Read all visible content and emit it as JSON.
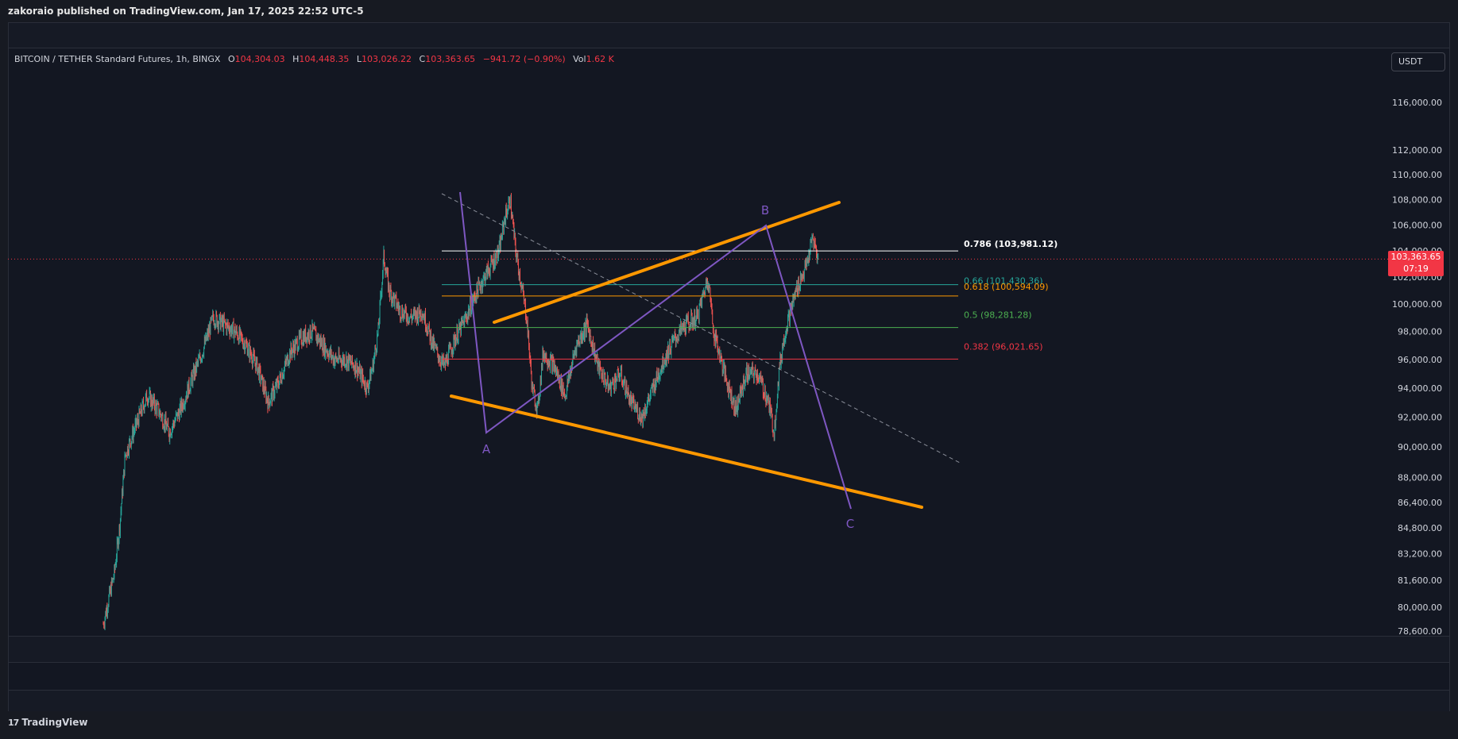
{
  "header": {
    "published": "zakoraio published on TradingView.com, Jan 17, 2025 22:52 UTC-5"
  },
  "legend": {
    "symbol": "BITCOIN / TETHER Standard Futures, 1h, BINGX",
    "o_label": "O",
    "o": "104,304.03",
    "h_label": "H",
    "h": "104,448.35",
    "l_label": "L",
    "l": "103,026.22",
    "c_label": "C",
    "c": "103,363.65",
    "change": "−941.72 (−0.90%)",
    "vol_label": "Vol",
    "vol": "1.62 K"
  },
  "currency": "USDT",
  "last_price": {
    "value": "103,363.65",
    "countdown": "07:19",
    "color": "#f23645"
  },
  "brand": {
    "logo": "17",
    "name": "TradingView"
  },
  "colors": {
    "up": "#26a69a",
    "down": "#ef5350",
    "channel": "#ff9800",
    "wave": "#7e57c2",
    "fib_786": "#ffffff",
    "fib_66": "#26a69a",
    "fib_618": "#ff9800",
    "fib_5": "#4caf50",
    "fib_382": "#f23645"
  },
  "chart_data": {
    "type": "candlestick",
    "title": "BITCOIN / TETHER Standard Futures, 1h, BINGX",
    "ylim": [
      78000,
      118000
    ],
    "y_scale": "log",
    "y_ticks": [
      "116,000.00",
      "112,000.00",
      "110,000.00",
      "108,000.00",
      "106,000.00",
      "104,000.00",
      "102,000.00",
      "100,000.00",
      "98,000.00",
      "96,000.00",
      "94,000.00",
      "92,000.00",
      "90,000.00",
      "88,000.00",
      "86,400.00",
      "84,800.00",
      "83,200.00",
      "81,600.00",
      "80,000.00",
      "78,600.00"
    ],
    "price_path": [
      [
        0,
        79000
      ],
      [
        0.4,
        82000
      ],
      [
        0.6,
        85000
      ],
      [
        0.8,
        89500
      ],
      [
        1.2,
        91500
      ],
      [
        1.6,
        93500
      ],
      [
        2.0,
        92500
      ],
      [
        2.4,
        91000
      ],
      [
        2.8,
        92500
      ],
      [
        3.2,
        94500
      ],
      [
        3.6,
        96500
      ],
      [
        4.0,
        99000
      ],
      [
        4.4,
        98500
      ],
      [
        4.8,
        98000
      ],
      [
        5.2,
        97000
      ],
      [
        5.6,
        95500
      ],
      [
        6.0,
        93000
      ],
      [
        6.4,
        94500
      ],
      [
        6.8,
        96500
      ],
      [
        7.2,
        97500
      ],
      [
        7.6,
        98000
      ],
      [
        8.0,
        97000
      ],
      [
        8.4,
        96000
      ],
      [
        8.8,
        96000
      ],
      [
        9.2,
        95500
      ],
      [
        9.6,
        94000
      ],
      [
        9.8,
        95500
      ],
      [
        10.0,
        98000
      ],
      [
        10.2,
        103500
      ],
      [
        10.4,
        101000
      ],
      [
        10.8,
        99500
      ],
      [
        11.2,
        99000
      ],
      [
        11.6,
        99500
      ],
      [
        12.0,
        97000
      ],
      [
        12.4,
        95500
      ],
      [
        12.8,
        97500
      ],
      [
        13.2,
        99000
      ],
      [
        13.6,
        101000
      ],
      [
        14.0,
        102500
      ],
      [
        14.4,
        104000
      ],
      [
        14.6,
        106500
      ],
      [
        14.8,
        108000
      ],
      [
        15.0,
        104000
      ],
      [
        15.2,
        101500
      ],
      [
        15.4,
        99000
      ],
      [
        15.6,
        94000
      ],
      [
        15.8,
        92500
      ],
      [
        16.0,
        96500
      ],
      [
        16.4,
        95500
      ],
      [
        16.8,
        93500
      ],
      [
        17.2,
        97000
      ],
      [
        17.6,
        98500
      ],
      [
        18.0,
        95500
      ],
      [
        18.4,
        94000
      ],
      [
        18.8,
        95000
      ],
      [
        19.2,
        93000
      ],
      [
        19.6,
        92000
      ],
      [
        20.0,
        94000
      ],
      [
        20.4,
        96000
      ],
      [
        20.8,
        97500
      ],
      [
        21.2,
        98500
      ],
      [
        21.6,
        99000
      ],
      [
        22.0,
        102000
      ],
      [
        22.2,
        98000
      ],
      [
        22.6,
        95000
      ],
      [
        23.0,
        92500
      ],
      [
        23.4,
        95000
      ],
      [
        23.8,
        95000
      ],
      [
        24.2,
        93000
      ],
      [
        24.4,
        91000
      ],
      [
        24.6,
        95500
      ],
      [
        24.8,
        98000
      ],
      [
        25.2,
        101000
      ],
      [
        25.6,
        103000
      ],
      [
        25.8,
        105000
      ],
      [
        26.0,
        103400
      ]
    ],
    "fibonacci": [
      {
        "level": "0.786",
        "price": "103,981.12"
      },
      {
        "level": "0.66",
        "price": "101,430.36"
      },
      {
        "level": "0.618",
        "price": "100,594.09"
      },
      {
        "level": "0.5",
        "price": "98,281.28"
      },
      {
        "level": "0.382",
        "price": "96,021.65"
      }
    ],
    "wave_labels": [
      "A",
      "B",
      "C"
    ]
  }
}
